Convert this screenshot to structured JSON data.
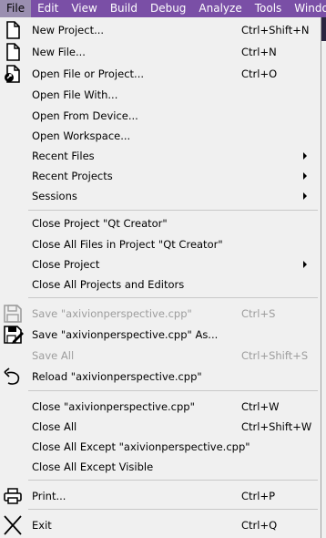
{
  "menubar": {
    "items": [
      "File",
      "Edit",
      "View",
      "Build",
      "Debug",
      "Analyze",
      "Tools",
      "Window"
    ]
  },
  "file_menu": {
    "new_project": {
      "label": "New Project...",
      "shortcut": "Ctrl+Shift+N"
    },
    "new_file": {
      "label": "New File...",
      "shortcut": "Ctrl+N"
    },
    "open_file_or_project": {
      "label": "Open File or Project...",
      "shortcut": "Ctrl+O"
    },
    "open_file_with": {
      "label": "Open File With..."
    },
    "open_from_device": {
      "label": "Open From Device..."
    },
    "open_workspace": {
      "label": "Open Workspace..."
    },
    "recent_files": {
      "label": "Recent Files"
    },
    "recent_projects": {
      "label": "Recent Projects"
    },
    "sessions": {
      "label": "Sessions"
    },
    "close_project": {
      "label": "Close Project \"Qt Creator\""
    },
    "close_all_files_in_project": {
      "label": "Close All Files in Project \"Qt Creator\""
    },
    "close_project_sub": {
      "label": "Close Project"
    },
    "close_all_projects_editors": {
      "label": "Close All Projects and Editors"
    },
    "save": {
      "label": "Save \"axivionperspective.cpp\"",
      "shortcut": "Ctrl+S"
    },
    "save_as": {
      "label": "Save \"axivionperspective.cpp\" As..."
    },
    "save_all": {
      "label": "Save All",
      "shortcut": "Ctrl+Shift+S"
    },
    "reload": {
      "label": "Reload \"axivionperspective.cpp\""
    },
    "close_file": {
      "label": "Close \"axivionperspective.cpp\"",
      "shortcut": "Ctrl+W"
    },
    "close_all": {
      "label": "Close All",
      "shortcut": "Ctrl+Shift+W"
    },
    "close_all_except": {
      "label": "Close All Except \"axivionperspective.cpp\""
    },
    "close_all_except_visible": {
      "label": "Close All Except Visible"
    },
    "print": {
      "label": "Print...",
      "shortcut": "Ctrl+P"
    },
    "exit": {
      "label": "Exit",
      "shortcut": "Ctrl+Q"
    }
  }
}
